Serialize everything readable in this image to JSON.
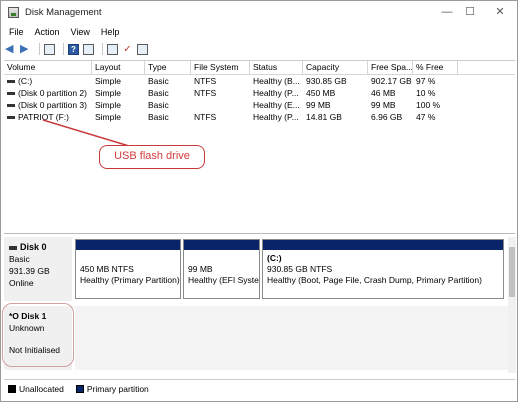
{
  "window": {
    "title": "Disk Management",
    "controls": [
      "—",
      "☐",
      "✕"
    ]
  },
  "menu": [
    "File",
    "Action",
    "View",
    "Help"
  ],
  "columns": [
    "Volume",
    "Layout",
    "Type",
    "File System",
    "Status",
    "Capacity",
    "Free Spa...",
    "% Free"
  ],
  "volumes": [
    {
      "volume": "(C:)",
      "layout": "Simple",
      "type": "Basic",
      "fs": "NTFS",
      "status": "Healthy (B...",
      "capacity": "930.85 GB",
      "free": "902.17 GB",
      "pct": "97 %"
    },
    {
      "volume": "(Disk 0 partition 2)",
      "layout": "Simple",
      "type": "Basic",
      "fs": "NTFS",
      "status": "Healthy (P...",
      "capacity": "450 MB",
      "free": "46 MB",
      "pct": "10 %"
    },
    {
      "volume": "(Disk 0 partition 3)",
      "layout": "Simple",
      "type": "Basic",
      "fs": "",
      "status": "Healthy (E...",
      "capacity": "99 MB",
      "free": "99 MB",
      "pct": "100 %"
    },
    {
      "volume": "PATRIOT (F:)",
      "layout": "Simple",
      "type": "Basic",
      "fs": "NTFS",
      "status": "Healthy (P...",
      "capacity": "14.81 GB",
      "free": "6.96 GB",
      "pct": "47 %"
    }
  ],
  "callout": "USB flash drive",
  "disk0": {
    "name": "Disk 0",
    "type": "Basic",
    "size": "931.39 GB",
    "state": "Online",
    "partitions": [
      {
        "name": "",
        "line1": "450 MB NTFS",
        "line2": "Healthy (Primary Partition)"
      },
      {
        "name": "",
        "line1": "99 MB",
        "line2": "Healthy (EFI System"
      },
      {
        "name": "(C:)",
        "line1": "930.85 GB NTFS",
        "line2": "Healthy (Boot, Page File, Crash Dump, Primary Partition)"
      }
    ]
  },
  "disk1": {
    "name": "*O Disk 1",
    "type": "Unknown",
    "state": "Not Initialised"
  },
  "legend": [
    {
      "label": "Unallocated",
      "color": "#000000"
    },
    {
      "label": "Primary partition",
      "color": "#0a246a"
    }
  ]
}
